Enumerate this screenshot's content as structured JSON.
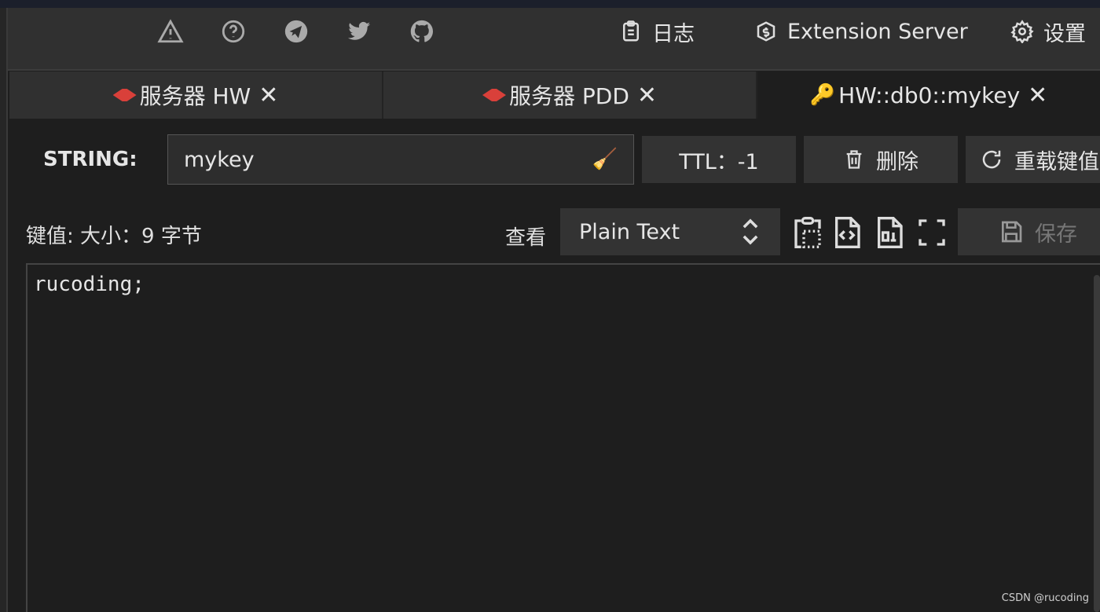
{
  "header": {
    "icons": [
      "warning-icon",
      "help-icon",
      "telegram-icon",
      "twitter-icon",
      "github-icon"
    ],
    "log_label": "日志",
    "extension_label": "Extension Server",
    "settings_label": "设置"
  },
  "tabs": [
    {
      "label": "服务器 HW",
      "icon": "redis-icon"
    },
    {
      "label": "服务器 PDD",
      "icon": "redis-icon"
    },
    {
      "label": "HW::db0::mykey",
      "icon": "key-icon"
    }
  ],
  "key": {
    "type_label": "STRING:",
    "name": "mykey",
    "ttl_label": "TTL：-1",
    "delete_label": "删除",
    "reload_label": "重载键值"
  },
  "value": {
    "size_label": "键值: 大小：9 字节",
    "view_label": "查看",
    "view_mode": "Plain Text",
    "save_label": "保存",
    "content": "rucoding;"
  },
  "watermark": "CSDN @rucoding",
  "colors": {
    "accent_red": "#d9403a",
    "key_icon": "#f0a030"
  }
}
